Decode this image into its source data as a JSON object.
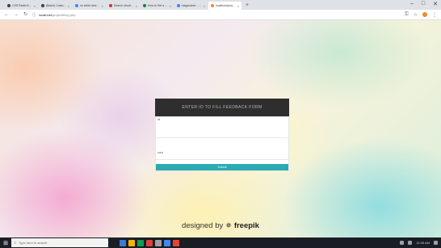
{
  "browser": {
    "tabs": [
      {
        "label": "CSS Radio Buttons",
        "favicon_color": "#3c4043",
        "active": false
      },
      {
        "label": "(Batch) Custom Drop-…",
        "favicon_color": "#3c4043",
        "active": false
      },
      {
        "label": "no white design back…",
        "favicon_color": "#4285f4",
        "active": false
      },
      {
        "label": "Search results - 1612…",
        "favicon_color": "#d93025",
        "active": false
      },
      {
        "label": "How to Set a Backgro…",
        "favicon_color": "#188038",
        "active": false
      },
      {
        "label": "stagename - Google S…",
        "favicon_color": "#4285f4",
        "active": false
      },
      {
        "label": "localhost/project5/au…",
        "favicon_color": "#f28b24",
        "active": true
      }
    ],
    "new_tab_glyph": "+",
    "window_controls": {
      "minimize": "–",
      "maximize": "□",
      "close": "✕"
    },
    "nav": {
      "back": "←",
      "forward": "→",
      "reload": "↻"
    },
    "address": {
      "host": "localhost",
      "path": "/project5/log.php"
    },
    "toolbar_icons": {
      "key": "⚿",
      "star": "☆",
      "menu": "⋮"
    }
  },
  "login": {
    "title": "ENTER ID TO FILL FEEDBACK FORM",
    "username_label": "Id",
    "username_value": "",
    "password_label": "",
    "password_value": "•••••",
    "submit_label": "Submit",
    "accent_color": "#2baab1"
  },
  "credit": {
    "prefix": "designed by",
    "brand": "freepik",
    "logo_glyph": "✵"
  },
  "taskbar": {
    "search_placeholder": "Type here to search",
    "time": "11:05 AM",
    "apps": [
      "#3a7bd5",
      "#f4b400",
      "#0f9d58",
      "#db4437",
      "#9aa0a6",
      "#4285f4",
      "#ea4335"
    ]
  }
}
